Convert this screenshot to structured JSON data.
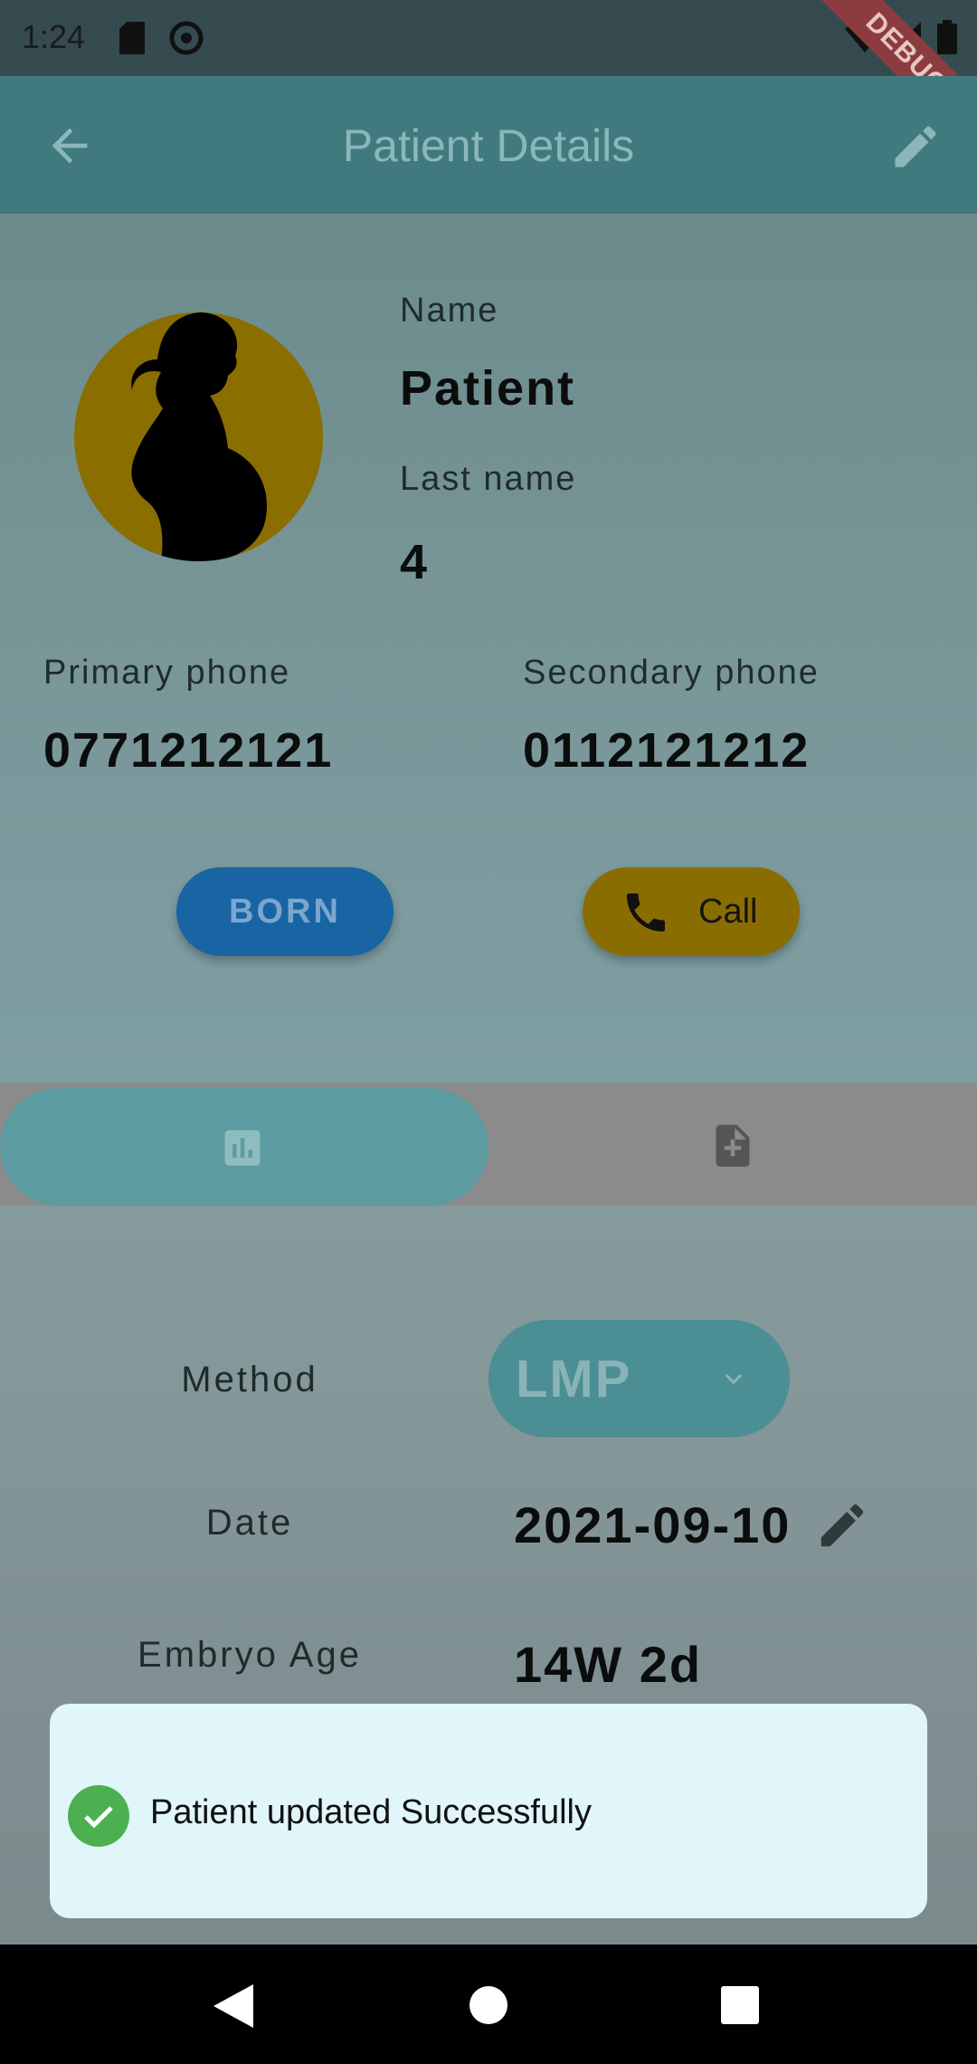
{
  "status_bar": {
    "time": "1:24",
    "debug_banner": "DEBUG"
  },
  "app_bar": {
    "title": "Patient Details"
  },
  "patient": {
    "name_label": "Name",
    "name": "Patient",
    "last_name_label": "Last name",
    "last_name": "4",
    "primary_phone_label": "Primary phone",
    "primary_phone": "0771212121",
    "secondary_phone_label": "Secondary phone",
    "secondary_phone": "0112121212"
  },
  "actions": {
    "born_label": "BORN",
    "call_label": "Call"
  },
  "tabs": [
    {
      "icon": "bar-chart-icon",
      "selected": true
    },
    {
      "icon": "add-document-icon",
      "selected": false
    }
  ],
  "pregnancy": {
    "method_label": "Method",
    "method_value": "LMP",
    "date_label": "Date",
    "date_value": "2021-09-10",
    "embryo_age_label": "Embryo Age",
    "embryo_age_value": "14W 2d"
  },
  "snackbar": {
    "message": "Patient updated Successfully",
    "status_color": "#4caf50"
  },
  "colors": {
    "app_bar": "#417a7e",
    "born_button": "#1965a4",
    "call_button": "#8a6d00",
    "avatar_bg": "#8a6e00",
    "snackbar_bg": "#e0f6fa"
  }
}
